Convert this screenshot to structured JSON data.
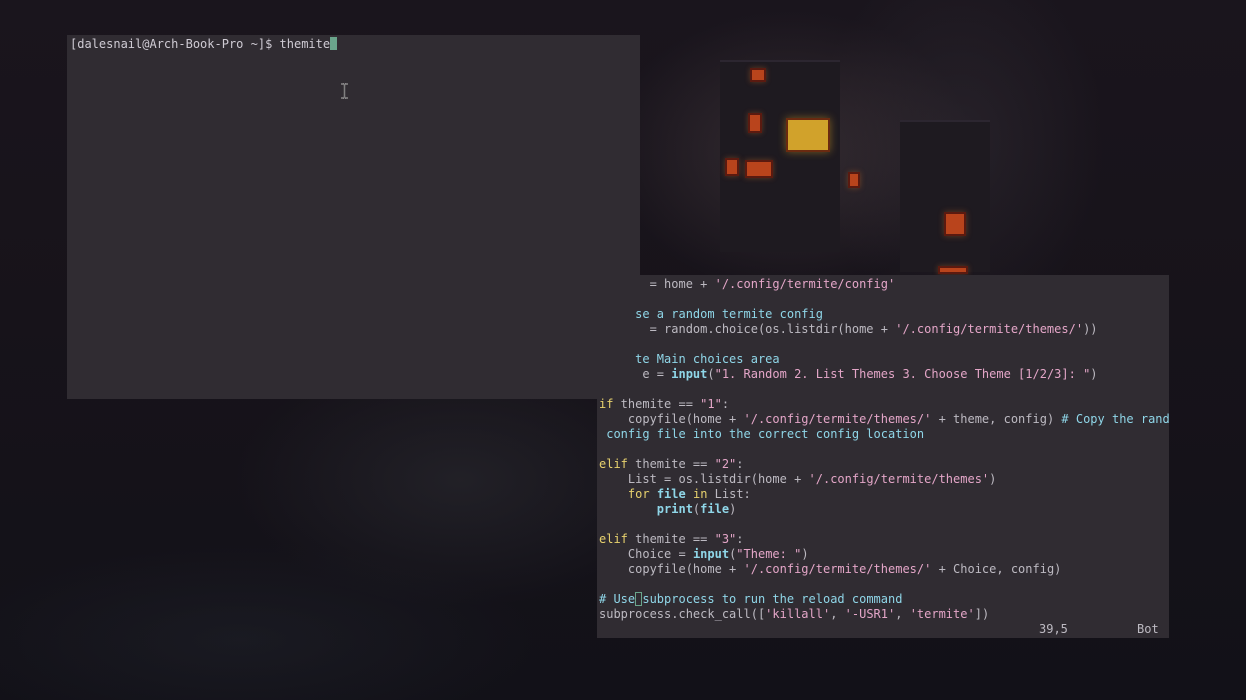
{
  "desktop": {
    "wallpaper": "pixel-art-night-city",
    "accent_colors": {
      "terminal_bg": "#302c32",
      "cursor": "#6aa58c",
      "keyword": "#e8d26e",
      "builtin": "#8fd6e8",
      "string": "#e4a6c8",
      "comment": "#8fd6e8"
    }
  },
  "terminal_top": {
    "prompt": "[dalesnail@Arch-Book-Pro ~]$",
    "command": "themite",
    "pointer_icon": "ibeam-cursor-icon"
  },
  "vim": {
    "lines": [
      {
        "indent": "",
        "parts": [
          {
            "t": "       = home + ",
            "c": "nm"
          },
          {
            "t": "'/.config/termite/config'",
            "c": "st"
          }
        ]
      },
      {
        "indent": "",
        "parts": []
      },
      {
        "indent": "",
        "parts": [
          {
            "t": "     se a random termite config",
            "c": "cm"
          }
        ]
      },
      {
        "indent": "",
        "parts": [
          {
            "t": "       = random.choice(os.listdir(home + ",
            "c": "nm"
          },
          {
            "t": "'/.config/termite/themes/'",
            "c": "st"
          },
          {
            "t": "))",
            "c": "nm"
          }
        ]
      },
      {
        "indent": "",
        "parts": []
      },
      {
        "indent": "",
        "parts": [
          {
            "t": "     te Main choices area",
            "c": "cm"
          }
        ]
      },
      {
        "indent": "",
        "parts": [
          {
            "t": "      e = ",
            "c": "nm"
          },
          {
            "t": "input",
            "c": "bi"
          },
          {
            "t": "(",
            "c": "nm"
          },
          {
            "t": "\"1. Random 2. List Themes 3. Choose Theme [1/2/3]: \"",
            "c": "st"
          },
          {
            "t": ")",
            "c": "nm"
          }
        ]
      },
      {
        "indent": "",
        "parts": []
      },
      {
        "indent": "",
        "parts": [
          {
            "t": "if",
            "c": "kw"
          },
          {
            "t": " themite == ",
            "c": "nm"
          },
          {
            "t": "\"1\"",
            "c": "st"
          },
          {
            "t": ":",
            "c": "nm"
          }
        ]
      },
      {
        "indent": "    ",
        "parts": [
          {
            "t": "copyfile(home + ",
            "c": "nm"
          },
          {
            "t": "'/.config/termite/themes/'",
            "c": "st"
          },
          {
            "t": " + theme, config) ",
            "c": "nm"
          },
          {
            "t": "# Copy the random",
            "c": "cm"
          }
        ]
      },
      {
        "indent": "",
        "parts": [
          {
            "t": " config file into the correct config location",
            "c": "cm"
          }
        ]
      },
      {
        "indent": "",
        "parts": []
      },
      {
        "indent": "",
        "parts": [
          {
            "t": "elif",
            "c": "kw"
          },
          {
            "t": " themite == ",
            "c": "nm"
          },
          {
            "t": "\"2\"",
            "c": "st"
          },
          {
            "t": ":",
            "c": "nm"
          }
        ]
      },
      {
        "indent": "    ",
        "parts": [
          {
            "t": "List = os.listdir(home + ",
            "c": "nm"
          },
          {
            "t": "'/.config/termite/themes'",
            "c": "st"
          },
          {
            "t": ")",
            "c": "nm"
          }
        ]
      },
      {
        "indent": "    ",
        "parts": [
          {
            "t": "for",
            "c": "kw"
          },
          {
            "t": " ",
            "c": "nm"
          },
          {
            "t": "file",
            "c": "bi"
          },
          {
            "t": " ",
            "c": "nm"
          },
          {
            "t": "in",
            "c": "kw"
          },
          {
            "t": " List:",
            "c": "nm"
          }
        ]
      },
      {
        "indent": "        ",
        "parts": [
          {
            "t": "print",
            "c": "bi"
          },
          {
            "t": "(",
            "c": "nm"
          },
          {
            "t": "file",
            "c": "bi"
          },
          {
            "t": ")",
            "c": "nm"
          }
        ]
      },
      {
        "indent": "",
        "parts": []
      },
      {
        "indent": "",
        "parts": [
          {
            "t": "elif",
            "c": "kw"
          },
          {
            "t": " themite == ",
            "c": "nm"
          },
          {
            "t": "\"3\"",
            "c": "st"
          },
          {
            "t": ":",
            "c": "nm"
          }
        ]
      },
      {
        "indent": "    ",
        "parts": [
          {
            "t": "Choice = ",
            "c": "nm"
          },
          {
            "t": "input",
            "c": "bi"
          },
          {
            "t": "(",
            "c": "nm"
          },
          {
            "t": "\"Theme: \"",
            "c": "st"
          },
          {
            "t": ")",
            "c": "nm"
          }
        ]
      },
      {
        "indent": "    ",
        "parts": [
          {
            "t": "copyfile(home + ",
            "c": "nm"
          },
          {
            "t": "'/.config/termite/themes/'",
            "c": "st"
          },
          {
            "t": " + Choice, config)",
            "c": "nm"
          }
        ]
      },
      {
        "indent": "",
        "parts": []
      },
      {
        "indent": "",
        "parts": [
          {
            "t": "# Use",
            "c": "cm"
          },
          {
            "t": " ",
            "c": "cm",
            "cursor": true
          },
          {
            "t": "subprocess to run the reload command",
            "c": "cm"
          }
        ]
      },
      {
        "indent": "",
        "parts": [
          {
            "t": "subprocess.check_call([",
            "c": "nm"
          },
          {
            "t": "'killall'",
            "c": "st"
          },
          {
            "t": ", ",
            "c": "nm"
          },
          {
            "t": "'-USR1'",
            "c": "st"
          },
          {
            "t": ", ",
            "c": "nm"
          },
          {
            "t": "'termite'",
            "c": "st"
          },
          {
            "t": "])",
            "c": "nm"
          }
        ]
      }
    ],
    "status": {
      "position": "39,5",
      "scroll": "Bot"
    }
  }
}
